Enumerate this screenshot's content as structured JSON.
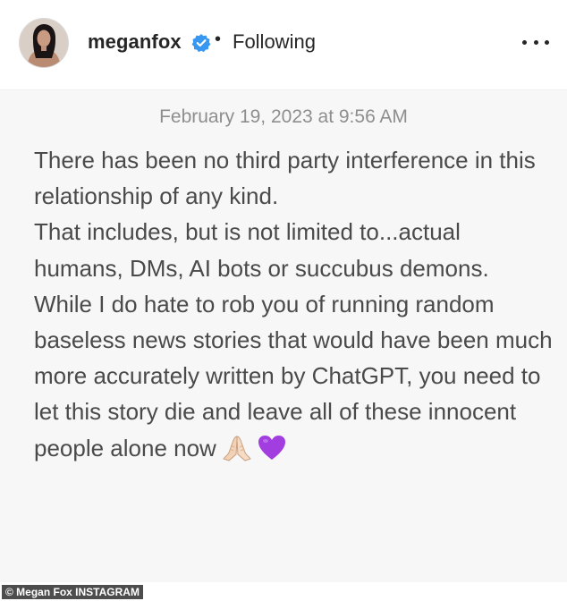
{
  "header": {
    "username": "meganfox",
    "separator": "•",
    "follow_status": "Following",
    "verified_icon": "verified-badge-icon",
    "more_icon": "more-options-icon",
    "accent_color": "#3897f0"
  },
  "note": {
    "timestamp": "February 19, 2023 at 9:56 AM",
    "paragraphs": [
      "There has been no third party interference in this relationship of any kind.",
      "That includes, but is not limited to...actual humans, DMs, AI bots or succubus demons.",
      "While I do hate to rob you of running random baseless news stories that would have been much more accurately written by ChatGPT, you need to let this story die and leave all of these innocent people alone now"
    ],
    "emojis": [
      "🙏🏼",
      "💜"
    ]
  },
  "caption": {
    "credit": "© Megan Fox INSTAGRAM"
  }
}
